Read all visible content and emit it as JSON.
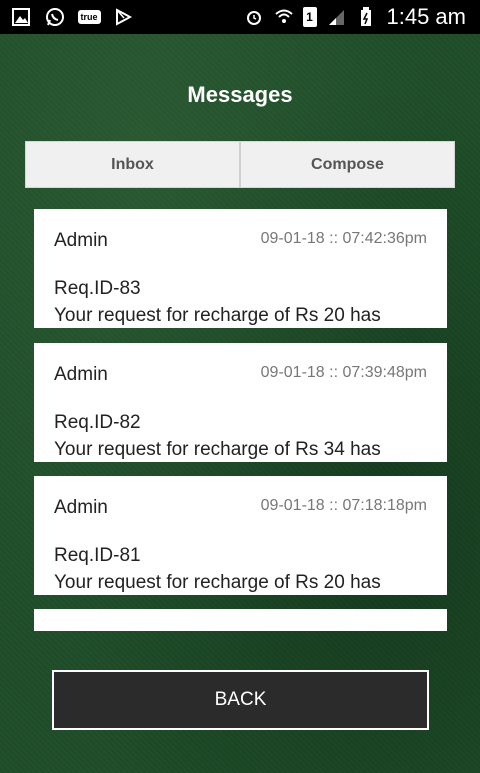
{
  "status_bar": {
    "left_icons": [
      "gallery-icon",
      "whatsapp-icon",
      "true-app-icon",
      "play-store-icon"
    ],
    "true_badge": "true",
    "sim_label": "1",
    "time": "1:45 am"
  },
  "header": {
    "title": "Messages"
  },
  "tabs": [
    {
      "label": "Inbox"
    },
    {
      "label": "Compose"
    }
  ],
  "messages": [
    {
      "sender": "Admin",
      "timestamp": "09-01-18 :: 07:42:36pm",
      "req_id": "Req.ID-83",
      "body": "Your request for recharge of Rs 20 has"
    },
    {
      "sender": "Admin",
      "timestamp": "09-01-18 :: 07:39:48pm",
      "req_id": "Req.ID-82",
      "body": "Your request for recharge of Rs 34 has"
    },
    {
      "sender": "Admin",
      "timestamp": "09-01-18 :: 07:18:18pm",
      "req_id": "Req.ID-81",
      "body": "Your request for recharge of Rs 20 has"
    }
  ],
  "back_button": {
    "label": "BACK"
  },
  "colors": {
    "background": "#1f4d29",
    "button": "#2b2b2b",
    "card": "#ffffff"
  }
}
